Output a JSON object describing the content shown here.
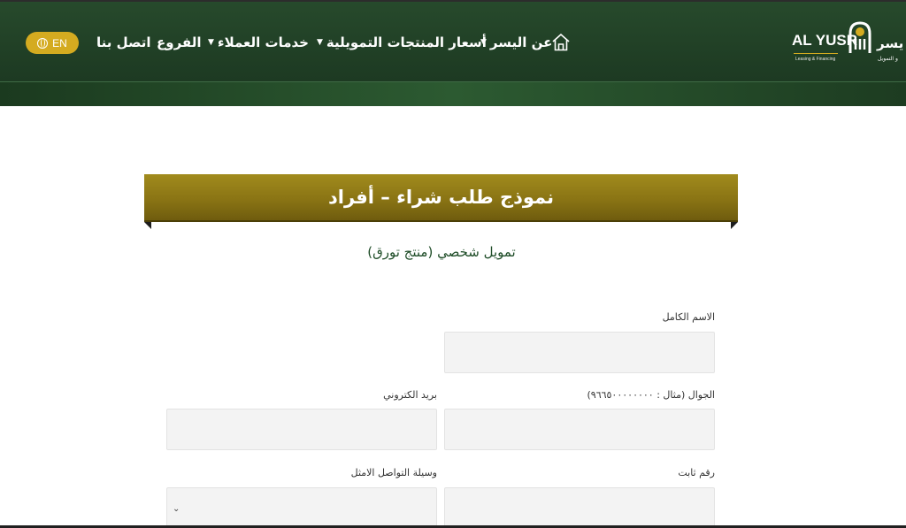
{
  "header": {
    "lang_label": "EN",
    "nav": {
      "about": "عن اليسر",
      "prices": "أسعار المنتجات التمويلية",
      "services": "خدمات العملاء",
      "branches": "الفروع",
      "contact": "اتصل بنا"
    },
    "logo": {
      "brand_en": "AL YUSR",
      "tagline_en": "Leasing & Financing",
      "brand_ar": "يسر",
      "tagline_ar": "و التمويل"
    }
  },
  "form": {
    "title": "نموذج طلب شراء – أفراد",
    "subtitle": "تمويل شخصي (منتج تورق)",
    "labels": {
      "full_name": "الاسم الكامل",
      "mobile": "الجوال (مثال : ٩٦٦٥٠٠٠٠٠٠٠٠)",
      "email": "بريد الكتروني",
      "landline": "رقم ثابت",
      "contact_method": "وسيلة التواصل الامثل"
    },
    "values": {
      "full_name": "",
      "mobile": "",
      "email": "",
      "landline": "",
      "contact_method": ""
    }
  },
  "colors": {
    "header_green": "#1f3d24",
    "gold": "#d4ab20",
    "banner_gold": "#8a7414",
    "subtitle_green": "#1f4d28",
    "field_bg": "#f3f3f3"
  },
  "icons": {
    "home": "home-icon",
    "globe": "globe-icon",
    "caret": "caret-down-icon",
    "select_chevron": "chevron-down-icon"
  }
}
